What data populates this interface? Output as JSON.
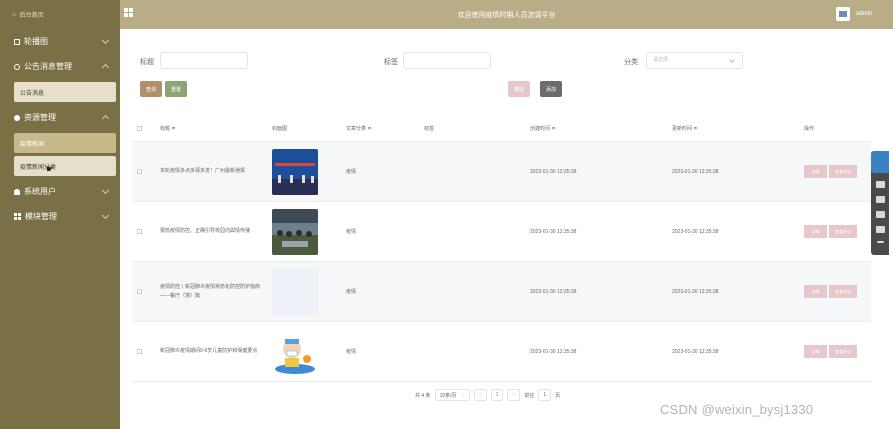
{
  "sidebar": {
    "home": "后台首页",
    "items": [
      {
        "label": "轮播图",
        "prefix": "轮播图"
      },
      {
        "label": "公告消息管理"
      },
      {
        "label": "公告消息"
      },
      {
        "label": "资源管理"
      },
      {
        "label": "疫情新闻"
      },
      {
        "label": "疫情新闻分类"
      },
      {
        "label": "系统用户"
      },
      {
        "label": "模块管理"
      }
    ]
  },
  "header": {
    "title": "欢迎使用疫情时期人员流调平台",
    "user": "admin"
  },
  "search": {
    "title_label": "标题",
    "tag_label": "标签",
    "category_label": "分类",
    "category_placeholder": "请选择",
    "query_button": "查询",
    "reset_button": "重置",
    "delete_button": "删除",
    "add_button": "添加"
  },
  "table": {
    "headers": {
      "title": "标题 ≑",
      "cover": "封面图",
      "category": "文章分类 ≑",
      "tags": "标签",
      "created": "创建时间 ≑",
      "updated": "更新时间 ≑",
      "ops": "操作"
    },
    "rows": [
      {
        "title": "本轮疫情多点多源多发！广州最新通报",
        "category": "疫情",
        "created": "2023-01-30 12:35:38",
        "updated": "2023-01-30 12:35:38",
        "detail": "详情",
        "comments": "查看评论"
      },
      {
        "title": "狠抓疫情防控、正确引导校园内舆情传播",
        "category": "疫情",
        "created": "2023-01-30 12:35:38",
        "updated": "2023-01-30 12:35:38",
        "detail": "详情",
        "comments": "查看评论"
      },
      {
        "title": "疫情防控丨新冠肺炎疫情常态化防控防护指南——餐厅（馆）篇",
        "category": "疫情",
        "created": "2023-01-30 12:35:38",
        "updated": "2023-01-30 12:35:38",
        "detail": "详情",
        "comments": "查看评论"
      },
      {
        "title": "新冠肺炎疫情期间0-6岁儿童防护和保健要点",
        "category": "疫情",
        "created": "2023-01-30 12:35:38",
        "updated": "2023-01-30 12:35:38",
        "detail": "详情",
        "comments": "查看评论"
      }
    ]
  },
  "pagination": {
    "total": "共 4 条",
    "page_size": "10条/页",
    "prev": "<",
    "current": "1",
    "next": ">",
    "goto_label": "前往",
    "goto_value": "1",
    "page_suffix": "页"
  },
  "watermark": "CSDN @weixin_bysj1330"
}
